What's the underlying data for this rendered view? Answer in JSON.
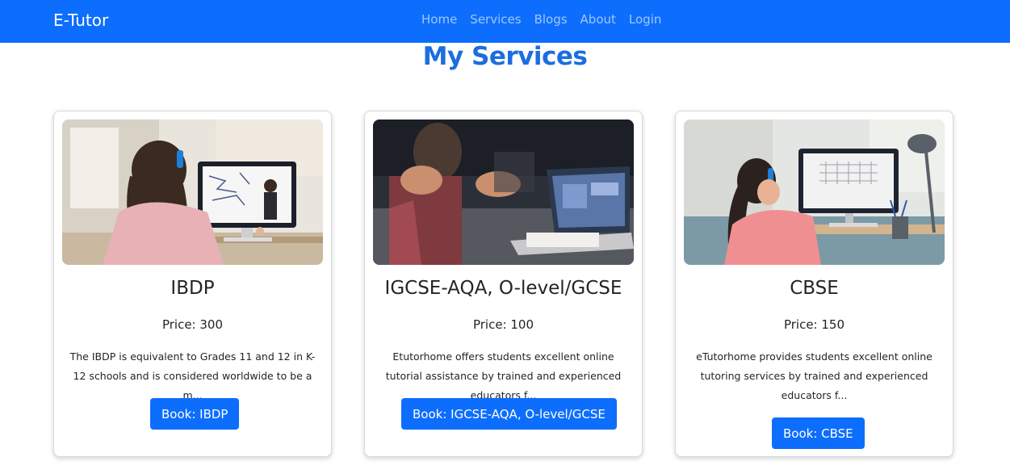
{
  "navbar": {
    "brand": "E-Tutor",
    "links": [
      "Home",
      "Services",
      "Blogs",
      "About",
      "Login"
    ],
    "color": "#0d6efd"
  },
  "page_title": "My Services",
  "services": [
    {
      "title": "IBDP",
      "price": "Price: 300",
      "description": "The IBDP is equivalent to Grades 11 and 12 in K-12 schools and is considered worldwide to be a m...",
      "button": "Book: IBDP",
      "image": "student-at-computer-with-headphones"
    },
    {
      "title": "IGCSE-AQA, O-level/GCSE",
      "price": "Price: 100",
      "description": "Etutorhome offers students excellent online tutorial assistance by trained and experienced educators f...",
      "button": "Book: IGCSE-AQA, O-level/GCSE",
      "image": "people-discussing-at-laptop"
    },
    {
      "title": "CBSE",
      "price": "Price: 150",
      "description": "eTutorhome provides students excellent online tutoring services by trained and experienced educators f...",
      "button": "Book: CBSE",
      "image": "girl-at-computer-with-headphones"
    }
  ]
}
